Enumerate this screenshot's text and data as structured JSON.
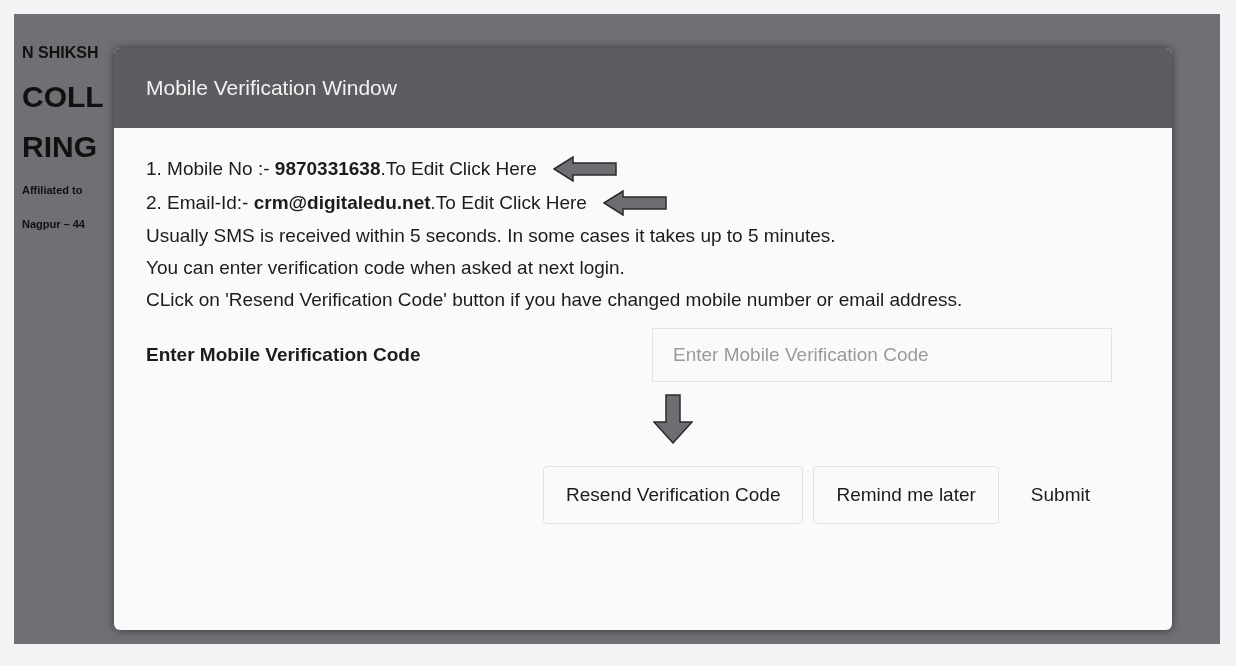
{
  "background_page": {
    "lines": [
      {
        "text": "N SHIKSH",
        "kind": "small"
      },
      {
        "text": "COLL",
        "kind": "big"
      },
      {
        "text": "RING",
        "kind": "big"
      },
      {
        "text": "Affiliated to",
        "kind": "tiny"
      },
      {
        "text": "Nagpur – 44",
        "kind": "tiny"
      }
    ]
  },
  "modal": {
    "title": "Mobile Verification Window",
    "contact_lines": [
      {
        "label": "1. Mobile No :- ",
        "value": "9870331638",
        "link": ".To Edit Click Here",
        "arrow": true
      },
      {
        "label": "2. Email-Id:- ",
        "value": "crm@digitaledu.net",
        "link": ".To Edit Click Here",
        "arrow": true
      }
    ],
    "notes": [
      "Usually SMS is received within 5 seconds. In some cases it takes up to 5 minutes.",
      "You can enter verification code when asked at next login.",
      "CLick on 'Resend Verification Code' button if you have changed mobile number or email address."
    ],
    "code_field": {
      "label": "Enter Mobile Verification Code",
      "placeholder": "Enter Mobile Verification Code"
    },
    "buttons": [
      {
        "label": "Resend Verification Code",
        "kind": "outlined",
        "arrow": true
      },
      {
        "label": "Remind me later",
        "kind": "outlined",
        "arrow": false
      },
      {
        "label": "Submit",
        "kind": "plain",
        "arrow": false
      }
    ]
  }
}
